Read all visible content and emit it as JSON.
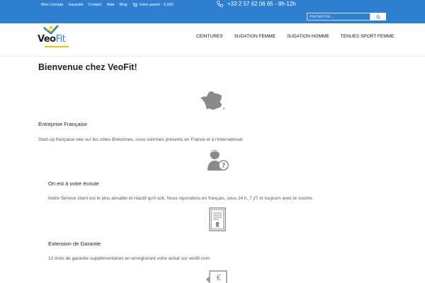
{
  "topbar": {
    "links": [
      "Mon Compte",
      "Garantie",
      "Contact",
      "Aide",
      "Blog"
    ],
    "cart_label": "Votre panier - 0,00€",
    "phone": "+33 2 57 62 06 65 - 8h-12h",
    "search_placeholder": "Recherche..."
  },
  "logo": {
    "veo": "Veo",
    "fit": "Fit"
  },
  "main_nav": [
    "CEINTURES",
    "SUDATION FEMME",
    "SUDATION HOMME",
    "TENUES SPORT FEMME"
  ],
  "page": {
    "title": "Bienvenue chez VeoFit!",
    "features": [
      {
        "heading": "Entreprise Française",
        "text": "Start-up française née sur les côtes Bretonnes, nous sommes présents en France et à l'international."
      },
      {
        "heading": "On est à votre écoute",
        "text": "Notre Service client est le plus aimable et réactif qu'il soit. Nous répondons en français, sous 24 h, 7 j/7 et toujours avec le sourire."
      },
      {
        "heading": "Extension de Garantie",
        "text": "12 mois de garantie supplémentaires en enregistrant votre achat sur veofit.com"
      }
    ]
  },
  "colors": {
    "brand_blue": "#2e7fcf",
    "accent_yellow": "#f1c40f",
    "icon_gray": "#8a8a8a"
  }
}
